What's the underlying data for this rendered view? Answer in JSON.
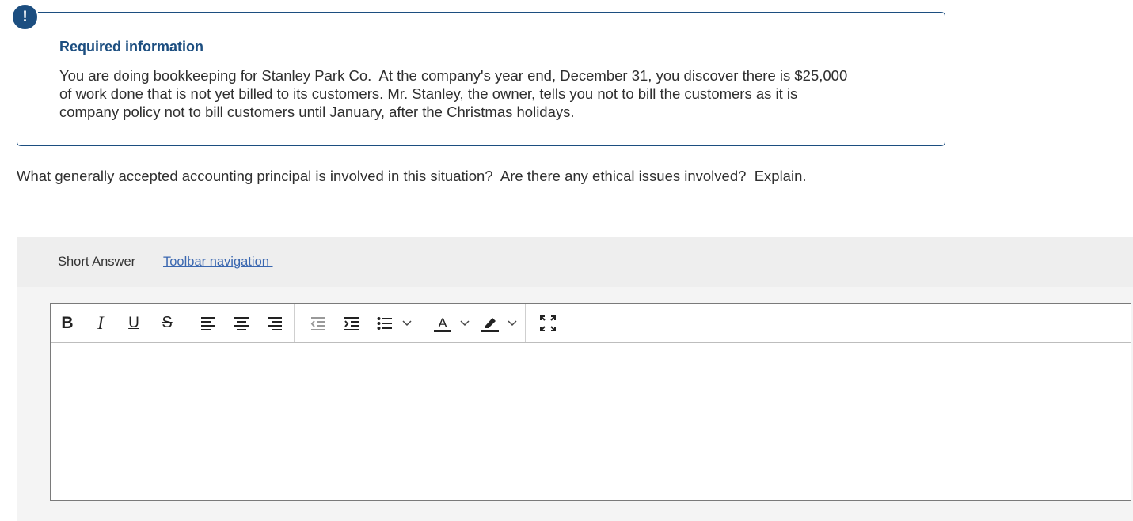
{
  "required_info": {
    "badge": "!",
    "title": "Required information",
    "text": "You are doing bookkeeping for Stanley Park Co.  At the company's year end, December 31, you discover there is $25,000\nof work done that is not yet billed to its customers. Mr. Stanley, the owner, tells you not to bill the customers as it is\ncompany policy not to bill customers until January, after the Christmas holidays."
  },
  "question": "What generally accepted accounting principal is involved in this situation?  Are there any ethical issues involved?  Explain.",
  "answer": {
    "type_label": "Short Answer",
    "toolbar_link": "Toolbar navigation ",
    "value": ""
  },
  "toolbar": {
    "bold": "B",
    "italic": "I",
    "underline": "U",
    "strike": "S"
  },
  "colors": {
    "accent": "#1c4e80",
    "link": "#3a67b0",
    "panel": "#f4f4f4"
  }
}
